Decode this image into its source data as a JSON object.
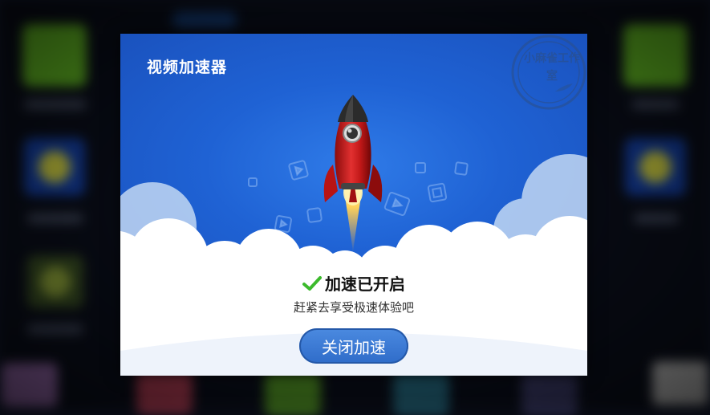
{
  "dialog": {
    "title": "视频加速器",
    "status": "加速已开启",
    "subtitle": "赶紧去享受极速体验吧",
    "close_button": "关闭加速",
    "watermark": "小麻雀工作室"
  },
  "icons": {
    "check": "check-icon",
    "rocket": "rocket-icon",
    "seal": "studio-seal"
  },
  "colors": {
    "sky": "#1f62d4",
    "check": "#3cba2c",
    "button": "#3a78d4"
  }
}
